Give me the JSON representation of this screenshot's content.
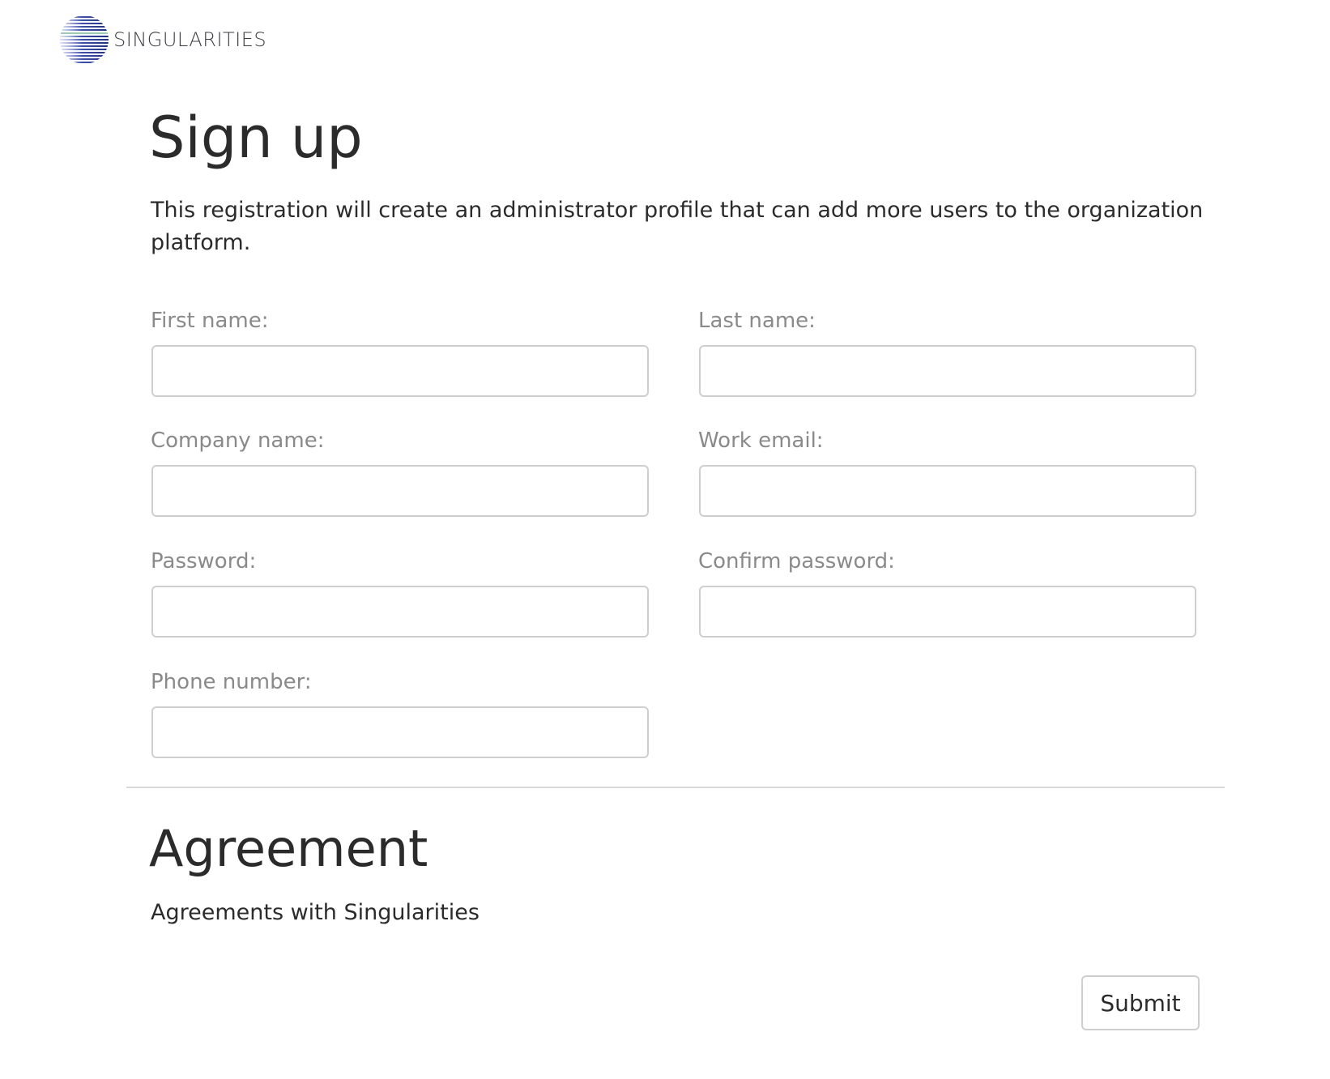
{
  "brand": {
    "name": "SINGULARITIES",
    "logo_icon": "striped-globe-logo-icon",
    "logo_colors": [
      "#1a2a8c",
      "#3b4fc4",
      "#8fa6ff",
      "#4caf7a"
    ]
  },
  "signup": {
    "title": "Sign up",
    "intro": "This registration will create an administrator profile that can add more users to the organization platform."
  },
  "form": {
    "first_name": {
      "label": "First name:",
      "value": "",
      "placeholder": ""
    },
    "last_name": {
      "label": "Last name:",
      "value": "",
      "placeholder": ""
    },
    "company_name": {
      "label": "Company name:",
      "value": "",
      "placeholder": ""
    },
    "work_email": {
      "label": "Work email:",
      "value": "",
      "placeholder": ""
    },
    "password": {
      "label": "Password:",
      "value": "",
      "placeholder": ""
    },
    "confirm_password": {
      "label": "Confirm password:",
      "value": "",
      "placeholder": ""
    },
    "phone_number": {
      "label": "Phone number:",
      "value": "",
      "placeholder": ""
    }
  },
  "agreement": {
    "title": "Agreement",
    "text": "Agreements with Singularities"
  },
  "actions": {
    "submit_label": "Submit"
  }
}
